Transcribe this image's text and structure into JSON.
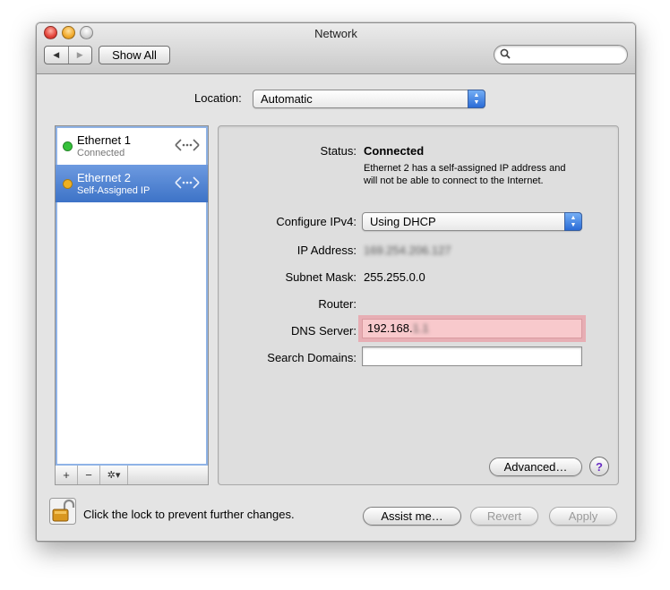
{
  "window": {
    "title": "Network",
    "show_all": "Show All",
    "back": "◀",
    "forward": "▶",
    "search_placeholder": ""
  },
  "location": {
    "label": "Location:",
    "value": "Automatic"
  },
  "services": [
    {
      "name": "Ethernet 1",
      "status": "Connected",
      "dot_color": "#35c13a",
      "selected": false
    },
    {
      "name": "Ethernet 2",
      "status": "Self-Assigned IP",
      "dot_color": "#f0b020",
      "selected": true
    }
  ],
  "list_toolbar": {
    "add": "+",
    "remove": "−",
    "gear": "✲▾"
  },
  "details": {
    "status_label": "Status:",
    "status_value": "Connected",
    "status_desc": "Ethernet 2 has a self-assigned IP address and will not be able to connect to the Internet.",
    "configure_label": "Configure IPv4:",
    "configure_value": "Using DHCP",
    "ip_label": "IP Address:",
    "ip_value": "169.254.206.127",
    "subnet_label": "Subnet Mask:",
    "subnet_value": "255.255.0.0",
    "router_label": "Router:",
    "router_value": "",
    "dns_label": "DNS Server:",
    "dns_value_visible": "192.168.",
    "dns_value_blurred": "1.1",
    "search_domains_label": "Search Domains:",
    "search_domains_value": ""
  },
  "buttons": {
    "advanced": "Advanced…",
    "help": "?",
    "assist": "Assist me…",
    "revert": "Revert",
    "apply": "Apply"
  },
  "lock": {
    "text": "Click the lock to prevent further changes."
  },
  "colors": {
    "accent": "#3d73c7",
    "dns_highlight": "#f8c9cc"
  }
}
